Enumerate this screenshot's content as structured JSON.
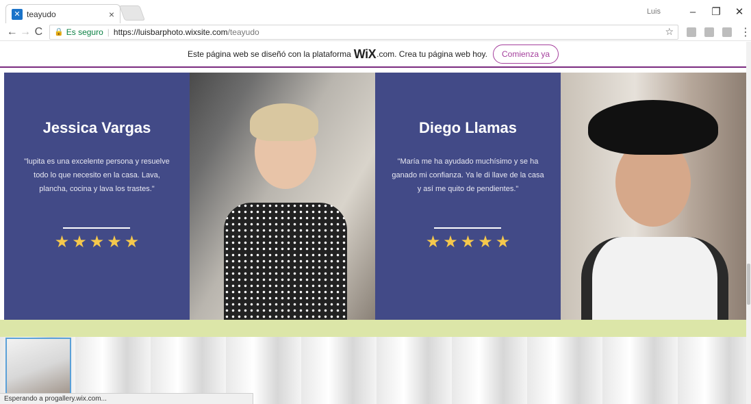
{
  "browser": {
    "tab_title": "teayudo",
    "tab_close": "×",
    "user_badge": "Luis",
    "win_min": "–",
    "win_max": "❐",
    "win_close": "✕",
    "back": "←",
    "forward": "→",
    "reload": "C",
    "secure_label": "Es seguro",
    "url_host": "https://luisbarphoto.wixsite.com",
    "url_path": "/teayudo",
    "bookmark": "☆",
    "menu": "⋮"
  },
  "banner": {
    "text": "Este página web se diseñó con la plataforma",
    "logo": "WiX",
    "suffix": ".com. Crea tu página web hoy.",
    "button": "Comienza ya"
  },
  "testimonials": [
    {
      "name": "Jessica Vargas",
      "quote": "\"lupita es una excelente persona y resuelve todo lo que necesito en la casa. Lava, plancha, cocina y lava los trastes.\"",
      "rating": 5
    },
    {
      "name": "Diego Llamas",
      "quote": "\"María me ha ayudado muchísimo y se ha ganado mi confianza. Ya le di llave de la casa y así me quito de pendientes.\"",
      "rating": 5
    }
  ],
  "status": "Esperando a progallery.wix.com...",
  "colors": {
    "panel": "#424a87",
    "star": "#f5c84c",
    "accent": "#a43e9c",
    "band": "#dce6a8"
  }
}
